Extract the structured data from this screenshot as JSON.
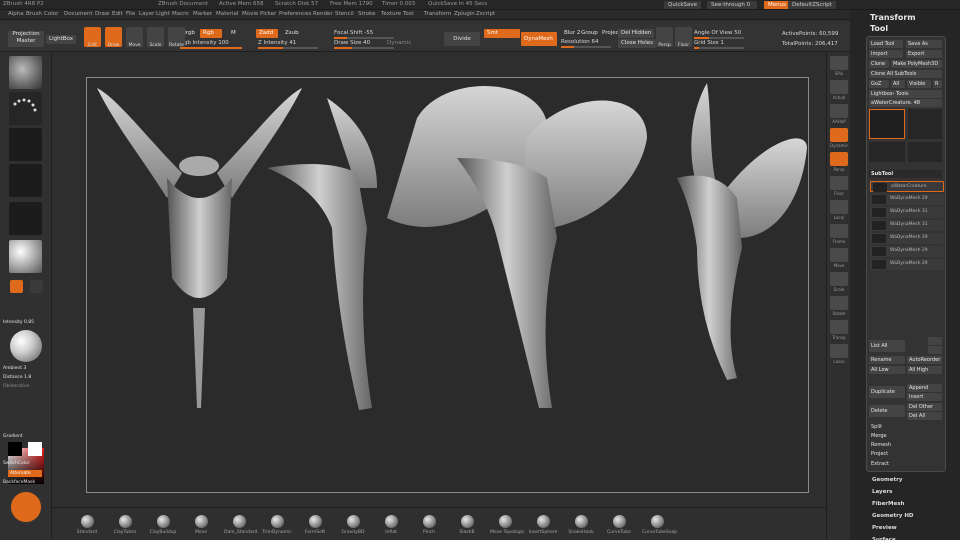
{
  "titlebar": {
    "app": "ZBrush 4R8 P2",
    "doc": "ZBrush Document",
    "active_mem": "Active Mem 658",
    "scratch": "Scratch Disk 57",
    "free_mem": "Free Mem 1790",
    "timer": "Timer 0.003",
    "quicksave_info": "QuickSave In 45 Secs",
    "quicksave_btn": "QuickSave",
    "seethrough": "See-through 0",
    "menus_btn": "Menus",
    "script_btn": "DefaultZScript"
  },
  "menubar": [
    "Alpha",
    "Brush",
    "Color",
    "Document",
    "Draw",
    "Edit",
    "File",
    "Layer",
    "Light",
    "Macro",
    "Marker",
    "Material",
    "Movie",
    "Picker",
    "Preferences",
    "Render",
    "Stencil",
    "Stroke",
    "Texture",
    "Tool",
    "Transform",
    "Zplugin",
    "Zscript"
  ],
  "shelf": {
    "projection": "Projection Master",
    "lightbox": "LightBox",
    "tools": [
      {
        "label": "Edit",
        "active": true
      },
      {
        "label": "Draw",
        "active": true
      },
      {
        "label": "Move",
        "active": false
      },
      {
        "label": "Scale",
        "active": false
      },
      {
        "label": "Rotate",
        "active": false
      }
    ],
    "mrgb": "Mrgb",
    "rgb": "Rgb",
    "m": "M",
    "zadd": "Zadd",
    "zsub": "Zsub",
    "rgb_intensity": "Rgb Intensity 100",
    "z_intensity": "Z Intensity 41",
    "focal_shift": "Focal Shift -55",
    "draw_size": "Draw Size 40",
    "dynamic": "Dynamic",
    "divide": "Divide",
    "smt": "Smt",
    "dynamesh": "DynaMesh",
    "blur": "Blur 2",
    "group": "Group",
    "project": "Projec",
    "del_hidden": "Del Hidden",
    "resolution": "Resolution 64",
    "close_holes": "Close Holes",
    "persp": "Persp",
    "floor": "Floor",
    "angle_of_view": "Angle Of View 50",
    "grid_size": "Grid Size 1",
    "active_points": "ActivePoints: 60,599",
    "total_points": "TotalPoints: 206,417"
  },
  "lefttray": {
    "intensity": "Intensity 0.85",
    "ambient": "Ambient 3",
    "distance": "Distance 1.8",
    "obliteration": "Obliteration",
    "gradient": "Gradient",
    "switchcolor": "SwitchColor",
    "alternate": "Alternate",
    "backface": "BackfaceMask"
  },
  "rightdock": [
    "SPix",
    "Actual",
    "AAHalf",
    "Dynamic",
    "Persp",
    "Floor",
    "Local",
    "Frame",
    "Move",
    "Scale",
    "Rotate",
    "Transp",
    "Lasso"
  ],
  "toolpanel": {
    "transform": "Transform",
    "tool": "Tool",
    "load_tool": "Load Tool",
    "save_as": "Save As",
    "import": "Import",
    "export": "Export",
    "clone": "Clone",
    "make_polymesh": "Make PolyMesh3D",
    "clone_all": "Clone All SubTools",
    "goz": "GoZ",
    "all": "All",
    "visible": "Visible",
    "r": "R",
    "lightbox_tools": "Lightbox› Tools",
    "current_tool": "aWaterCreature. 48",
    "thumbs": [
      "aWaterCreature",
      "Cylinder3D",
      "SimpleBrush",
      "PolyMesh3D",
      "aWaterCreature"
    ],
    "subtool_header": "SubTool",
    "subtools": [
      "aWaterCreature",
      "WaDynaMesh 29",
      "WaDynaMesh 31",
      "WaDynaMesh 31",
      "WaDynaMesh 29",
      "WaDynaMesh 29",
      "WaDynaMesh 29"
    ],
    "list_all": "List All",
    "rename": "Rename",
    "autoreorder": "AutoReorder",
    "all_low": "All Low",
    "all_high": "All High",
    "duplicate": "Duplicate",
    "append": "Append",
    "insert": "Insert",
    "delete": "Delete",
    "del_other": "Del Other",
    "del_all": "Del All",
    "split": "Split",
    "merge": "Merge",
    "remesh": "Remesh",
    "project": "Project",
    "extract": "Extract",
    "menus": [
      "Geometry",
      "Layers",
      "FiberMesh",
      "Geometry HD",
      "Preview",
      "Surface"
    ]
  },
  "brushes": [
    "Standard",
    "ClayTubes",
    "ClayBuildup",
    "Move",
    "Dam_Standard",
    "TrimDynamic",
    "FormSoft",
    "GravityBD",
    "Inflat",
    "Pinch",
    "SlashB",
    "Move Topologic",
    "InsertSphere",
    "SnakeHook",
    "CurveTube",
    "CurveTubeSnap"
  ],
  "colors": {
    "accent": "#e06a1b",
    "bg": "#2c2c2c"
  }
}
